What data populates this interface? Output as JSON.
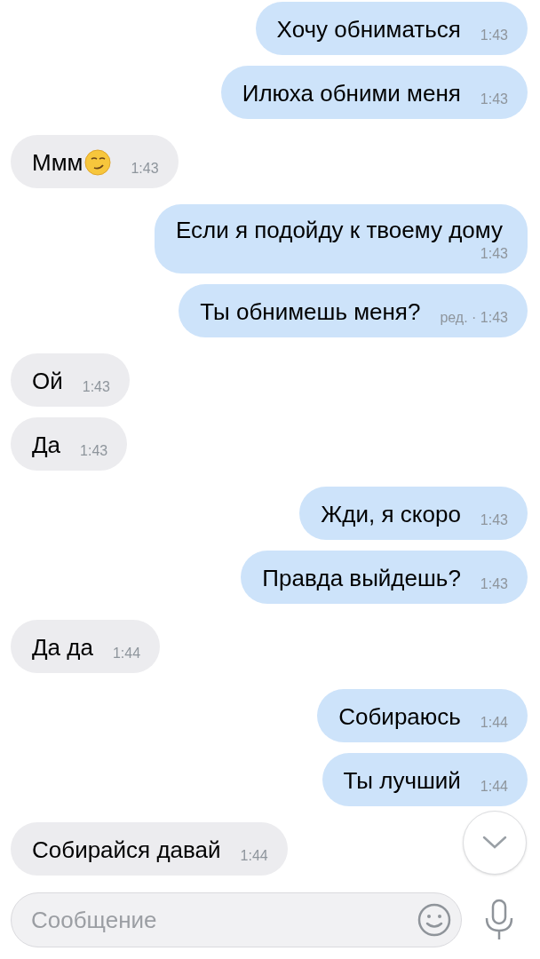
{
  "messages": [
    {
      "kind": "out",
      "text": "Хочу обниматься",
      "time": "1:43"
    },
    {
      "kind": "out",
      "text": "Илюха обними меня",
      "time": "1:43"
    },
    {
      "kind": "in",
      "text": "Ммм",
      "emoji": true,
      "time": "1:43"
    },
    {
      "kind": "out",
      "text": "Если я подойду к твоему дому",
      "time": "1:43"
    },
    {
      "kind": "out",
      "text": "Ты обнимешь меня?",
      "time": "ред. · 1:43"
    },
    {
      "kind": "in",
      "text": "Ой",
      "time": "1:43"
    },
    {
      "kind": "in",
      "text": "Да",
      "time": "1:43"
    },
    {
      "kind": "out",
      "text": "Жди, я скоро",
      "time": "1:43"
    },
    {
      "kind": "out",
      "text": "Правда выйдешь?",
      "time": "1:43"
    },
    {
      "kind": "in",
      "text": "Да да",
      "time": "1:44"
    },
    {
      "kind": "out",
      "text": "Собираюсь",
      "time": "1:44"
    },
    {
      "kind": "out",
      "text": "Ты лучший",
      "time": "1:44"
    },
    {
      "kind": "in",
      "text": "Собирайся давай",
      "time": "1:44"
    }
  ],
  "composer": {
    "placeholder": "Сообщение"
  }
}
